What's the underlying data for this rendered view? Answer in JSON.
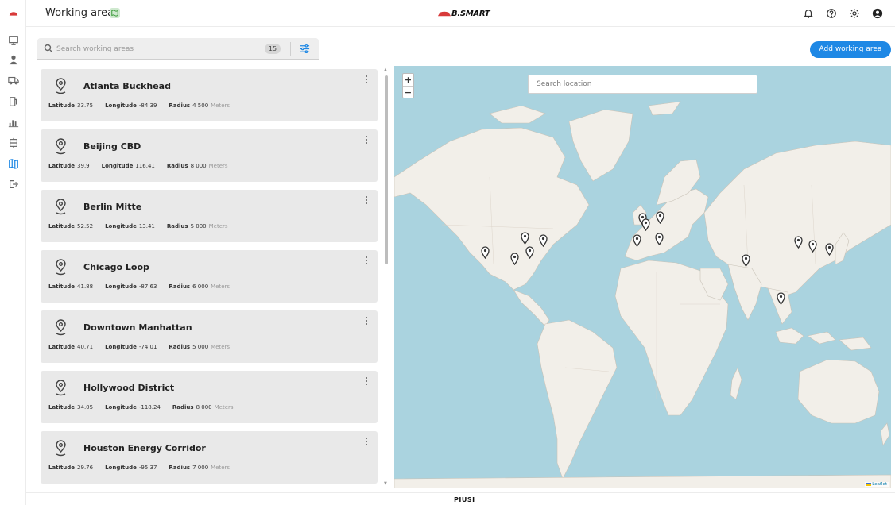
{
  "header": {
    "title": "Working areas",
    "brand": "B.SMART"
  },
  "search": {
    "placeholder": "Search working areas",
    "count": "15"
  },
  "actions": {
    "add_label": "Add working area"
  },
  "labels": {
    "latitude": "Latitude",
    "longitude": "Longitude",
    "radius": "Radius",
    "unit": "Meters"
  },
  "areas": [
    {
      "name": "Atlanta Buckhead",
      "lat": "33.75",
      "lng": "-84.39",
      "radius": "4 500"
    },
    {
      "name": "Beijing CBD",
      "lat": "39.9",
      "lng": "116.41",
      "radius": "8 000"
    },
    {
      "name": "Berlin Mitte",
      "lat": "52.52",
      "lng": "13.41",
      "radius": "5 000"
    },
    {
      "name": "Chicago Loop",
      "lat": "41.88",
      "lng": "-87.63",
      "radius": "6 000"
    },
    {
      "name": "Downtown Manhattan",
      "lat": "40.71",
      "lng": "-74.01",
      "radius": "5 000"
    },
    {
      "name": "Hollywood District",
      "lat": "34.05",
      "lng": "-118.24",
      "radius": "8 000"
    },
    {
      "name": "Houston Energy Corridor",
      "lat": "29.76",
      "lng": "-95.37",
      "radius": "7 000"
    }
  ],
  "map": {
    "search_placeholder": "Search location",
    "zoom_in": "+",
    "zoom_out": "−",
    "attribution": "Leaflet"
  },
  "footer": {
    "brand": "PIUSI"
  },
  "colors": {
    "accent": "#1e88e5",
    "water": "#aad3df",
    "land": "#f2efe9",
    "card": "#e9e9e9"
  }
}
